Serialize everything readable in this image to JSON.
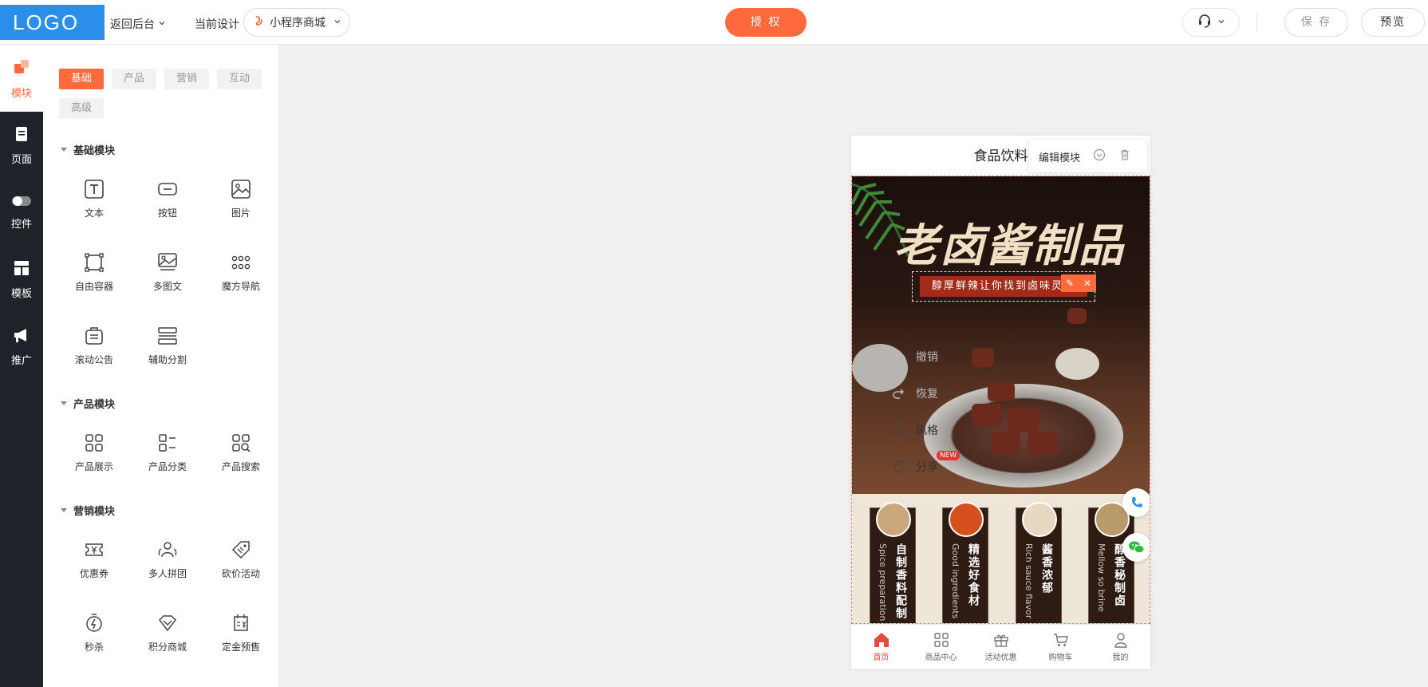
{
  "header": {
    "logo": "LOGO",
    "back_label": "返回后台",
    "current_design_label": "当前设计",
    "design_select_value": "小程序商城",
    "auth_label": "授 权",
    "save_label": "保 存",
    "preview_label": "预览"
  },
  "rail": {
    "items": [
      {
        "label": "模块",
        "icon": "blocks-icon"
      },
      {
        "label": "页面",
        "icon": "page-icon"
      },
      {
        "label": "控件",
        "icon": "toggle-icon"
      },
      {
        "label": "模板",
        "icon": "template-icon"
      },
      {
        "label": "推广",
        "icon": "megaphone-icon"
      }
    ]
  },
  "panel": {
    "tabs": [
      "基础",
      "产品",
      "营销",
      "互动",
      "高级"
    ],
    "sections": [
      {
        "title": "基础模块",
        "items": [
          {
            "label": "文本",
            "icon": "text-icon"
          },
          {
            "label": "按钮",
            "icon": "button-icon"
          },
          {
            "label": "图片",
            "icon": "image-icon"
          },
          {
            "label": "自由容器",
            "icon": "container-icon"
          },
          {
            "label": "多图文",
            "icon": "gallery-icon"
          },
          {
            "label": "魔方导航",
            "icon": "grid-nav-icon"
          },
          {
            "label": "滚动公告",
            "icon": "notice-icon"
          },
          {
            "label": "辅助分割",
            "icon": "divider-icon"
          }
        ]
      },
      {
        "title": "产品模块",
        "items": [
          {
            "label": "产品展示",
            "icon": "product-grid-icon"
          },
          {
            "label": "产品分类",
            "icon": "category-icon"
          },
          {
            "label": "产品搜索",
            "icon": "product-search-icon"
          }
        ]
      },
      {
        "title": "营销模块",
        "items": [
          {
            "label": "优惠券",
            "icon": "coupon-icon"
          },
          {
            "label": "多人拼团",
            "icon": "group-buy-icon"
          },
          {
            "label": "砍价活动",
            "icon": "bargain-icon"
          },
          {
            "label": "秒杀",
            "icon": "flash-sale-icon"
          },
          {
            "label": "积分商城",
            "icon": "points-mall-icon"
          },
          {
            "label": "定金预售",
            "icon": "presale-icon"
          }
        ]
      }
    ]
  },
  "phone": {
    "title": "食品饮料",
    "edit_module_label": "编辑模块",
    "headline": "老卤酱制品",
    "slogan": "醇厚鲜辣让你找到卤味灵魂",
    "features": [
      {
        "cn": "自制香料配制",
        "en": "Spice preparation",
        "color": "#c9a77a"
      },
      {
        "cn": "精选好食材",
        "en": "Good ingredients",
        "color": "#d6501e"
      },
      {
        "cn": "酱香浓郁",
        "en": "Rich sauce flavor",
        "color": "#e6d8c2"
      },
      {
        "cn": "醇香秘制卤",
        "en": "Mellow so brine",
        "color": "#b99a6a"
      }
    ],
    "tabbar": [
      {
        "label": "首页",
        "icon": "home-icon"
      },
      {
        "label": "商品中心",
        "icon": "grid-icon"
      },
      {
        "label": "活动优惠",
        "icon": "gift-icon"
      },
      {
        "label": "购物车",
        "icon": "cart-icon"
      },
      {
        "label": "我的",
        "icon": "user-icon"
      }
    ]
  },
  "side_actions": {
    "undo": "撤销",
    "redo": "恢复",
    "style": "风格",
    "share": "分享",
    "new_badge": "NEW"
  },
  "colors": {
    "accent": "#ff6a3c",
    "logo_bg": "#2b8ee8",
    "rail_bg": "#1f2329"
  }
}
